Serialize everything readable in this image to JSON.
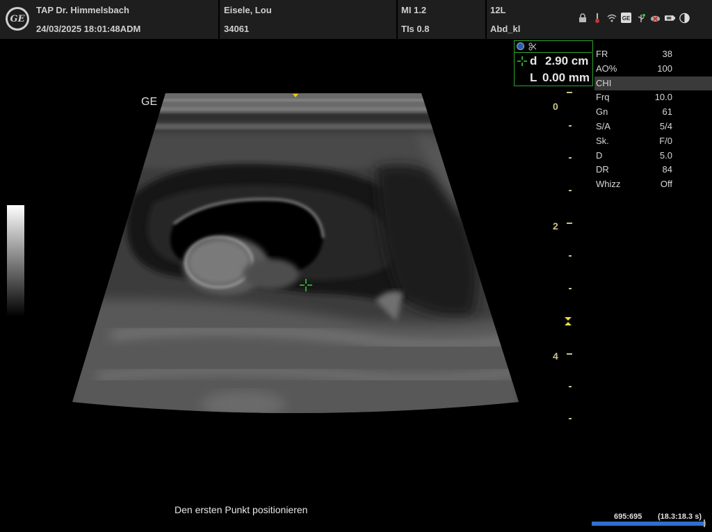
{
  "header": {
    "institution": "TAP Dr. Himmelsbach",
    "datetime": "24/03/2025 18:01:48ADM",
    "patient_name": "Eisele, Lou",
    "patient_id": "34061",
    "mi": "MI 1.2",
    "tis": "TIs 0.8",
    "probe": "12L",
    "preset": "Abd_kl",
    "logo_text": "GE"
  },
  "status_icons": [
    "lock-icon",
    "thermometer-icon",
    "wifi-icon",
    "ge-service-icon",
    "usb-icon",
    "network-disconnected-icon",
    "battery-icon",
    "contrast-icon"
  ],
  "image": {
    "brand_label": "GE",
    "depth_labels": [
      "0",
      "2",
      "4"
    ]
  },
  "measurement": {
    "d_label": "d",
    "d_value": "2.90 cm",
    "l_label": "L",
    "l_value": "0.00 mm",
    "cursor_color": "#33d633"
  },
  "parameters": [
    {
      "label": "FR",
      "value": "38"
    },
    {
      "label": "AO%",
      "value": "100"
    },
    {
      "label": "CHI",
      "value": ""
    },
    {
      "label": "Frq",
      "value": "10.0"
    },
    {
      "label": "Gn",
      "value": "61"
    },
    {
      "label": "S/A",
      "value": "5/4"
    },
    {
      "label": "Sk.",
      "value": "F/0"
    },
    {
      "label": "D",
      "value": "5.0"
    },
    {
      "label": "DR",
      "value": "84"
    },
    {
      "label": "Whizz",
      "value": "Off"
    }
  ],
  "prompt": "Den ersten Punkt positionieren",
  "cine": {
    "frames": "695:695",
    "time": "(18.3:18.3 s)",
    "progress": 1.0
  },
  "colors": {
    "scale_color": "#c9c48a",
    "measure_border": "#2ea82e",
    "cine_bar": "#2f6fd0"
  }
}
